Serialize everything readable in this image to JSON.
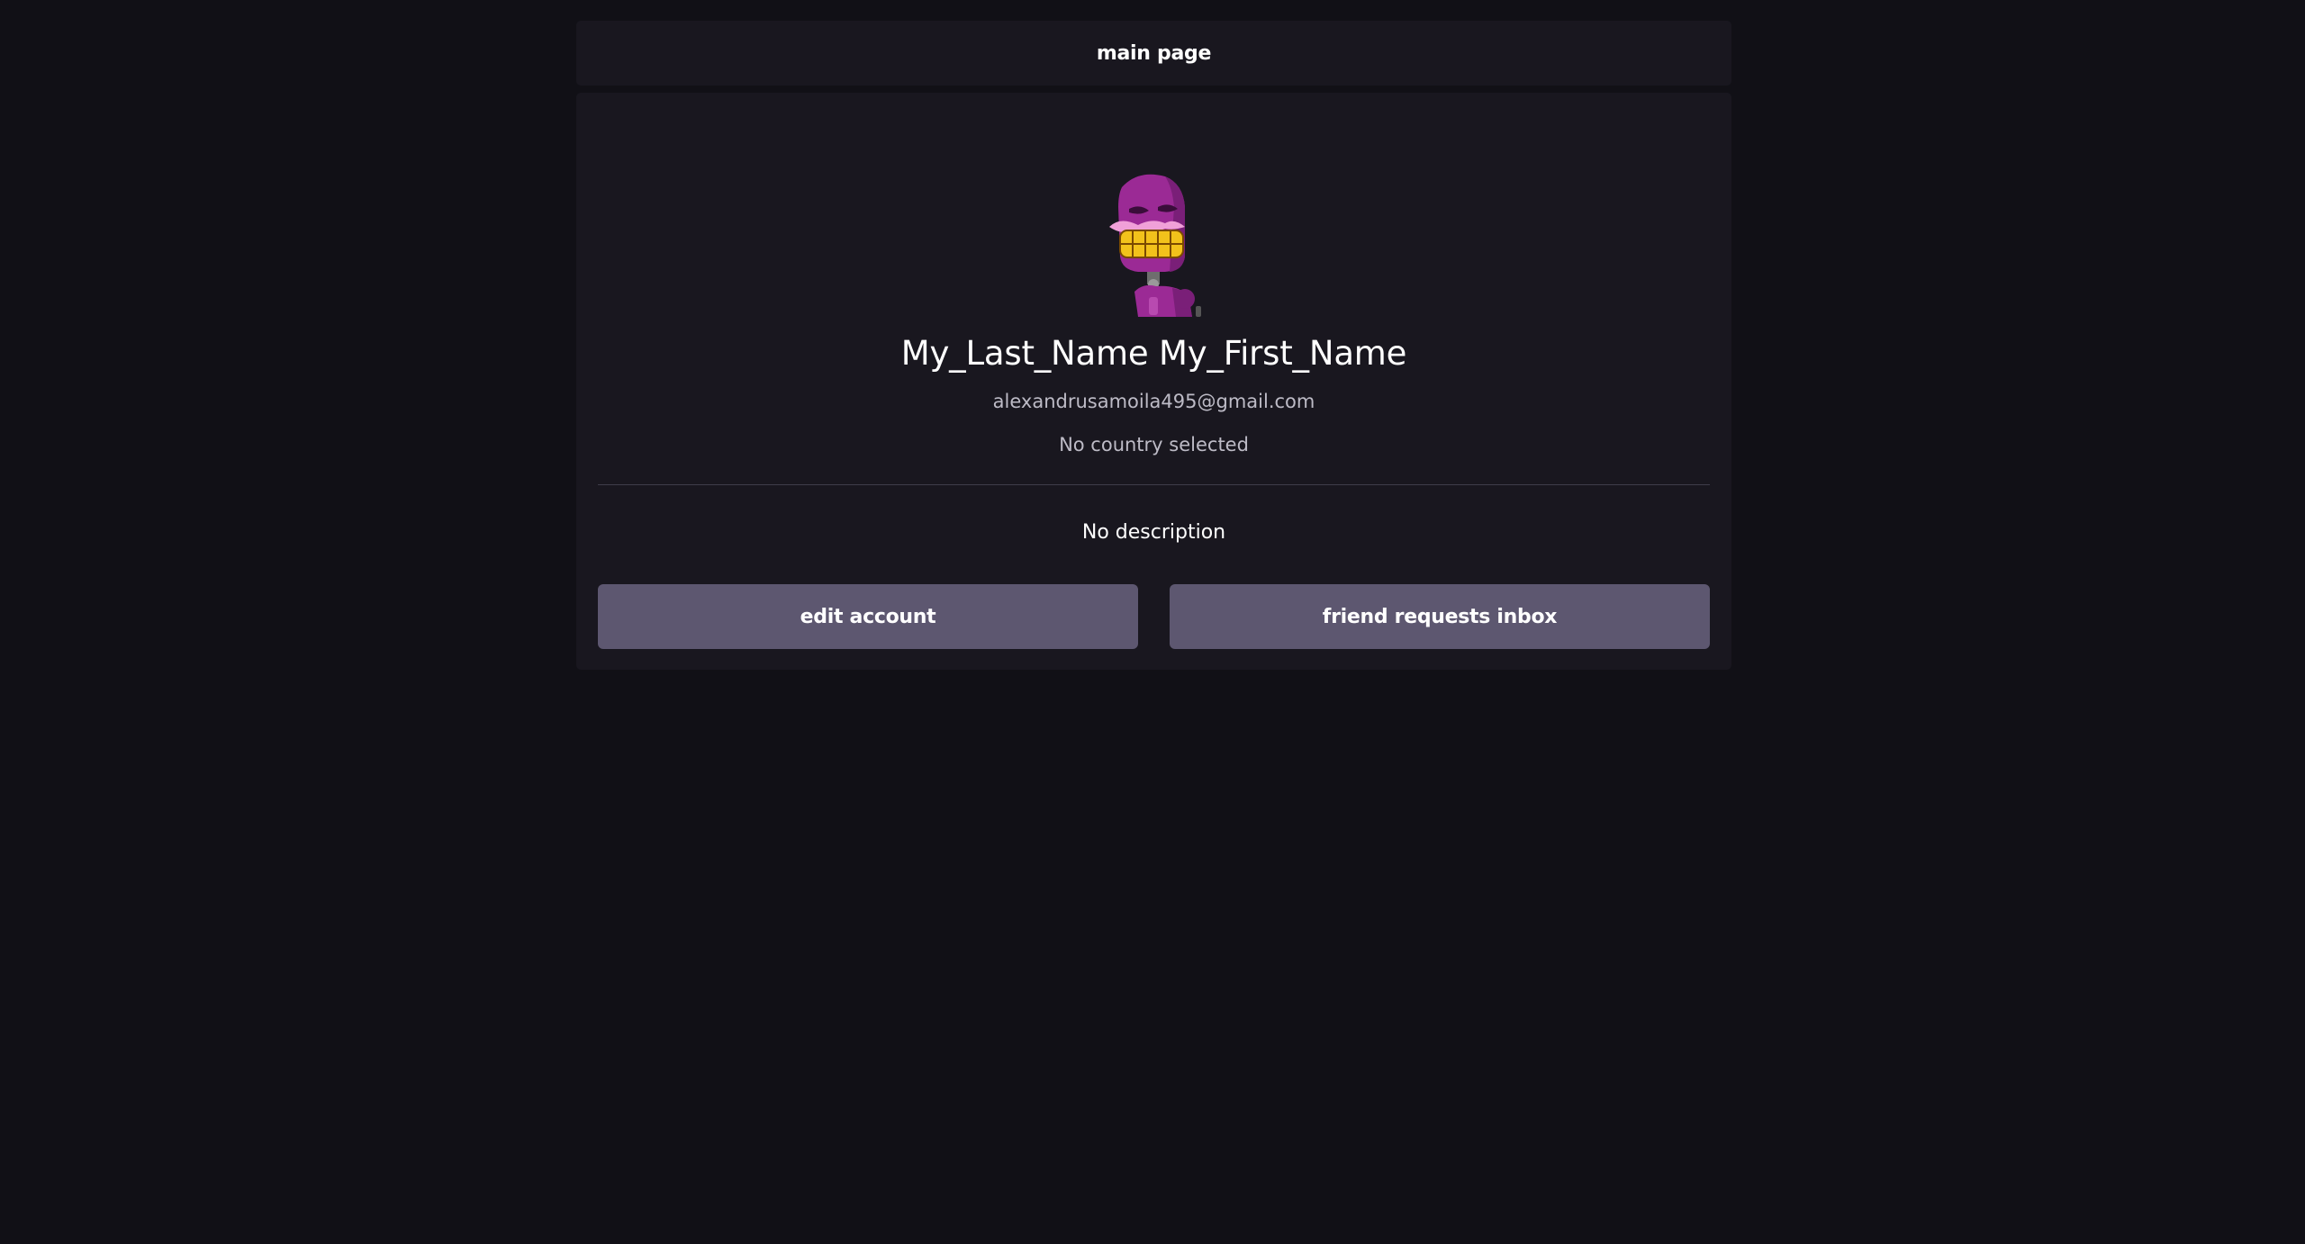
{
  "header": {
    "title": "main page"
  },
  "profile": {
    "avatar_icon": "purple-robot-avatar-icon",
    "name": "My_Last_Name My_First_Name",
    "email": "alexandrusamoila495@gmail.com",
    "country": "No country selected",
    "description": "No description"
  },
  "actions": {
    "edit_label": "edit account",
    "inbox_label": "friend requests inbox"
  },
  "colors": {
    "background": "#111016",
    "panel": "#19171f",
    "button": "#5d5770",
    "avatar_primary": "#9b2a95",
    "avatar_teeth": "#f2c21b"
  }
}
